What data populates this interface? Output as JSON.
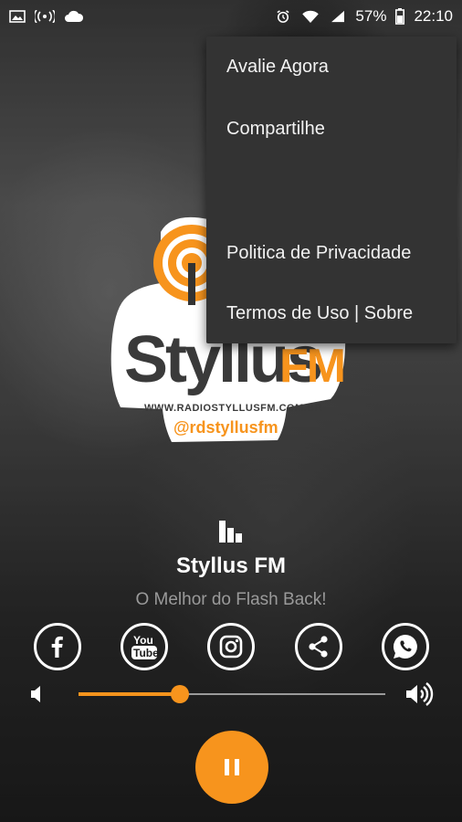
{
  "statusbar": {
    "battery_percent": "57%",
    "time": "22:10",
    "icons": [
      "image-icon",
      "hotspot-icon",
      "cloud-icon",
      "alarm-icon",
      "wifi-icon",
      "signal-icon",
      "battery-icon"
    ]
  },
  "menu": {
    "items": [
      {
        "label": "Avalie Agora"
      },
      {
        "label": "Compartilhe"
      },
      {
        "label": ""
      },
      {
        "label": "Politica de Privacidade"
      },
      {
        "label": "Termos de Uso | Sobre"
      }
    ]
  },
  "logo": {
    "brand_part1": "Styllus",
    "brand_part2": "FM",
    "website": "WWW.RADIOSTYLLUSFM.COM.BR",
    "handle": "@rdstyllusfm"
  },
  "player": {
    "station_name": "Styllus FM",
    "slogan": "O Melhor do Flash Back!",
    "volume_fraction": 0.33
  },
  "social": [
    "facebook-icon",
    "youtube-icon",
    "instagram-icon",
    "share-icon",
    "whatsapp-icon"
  ],
  "colors": {
    "accent": "#f7941d",
    "menu_bg": "#333333",
    "slogan": "#9a9a9a"
  }
}
